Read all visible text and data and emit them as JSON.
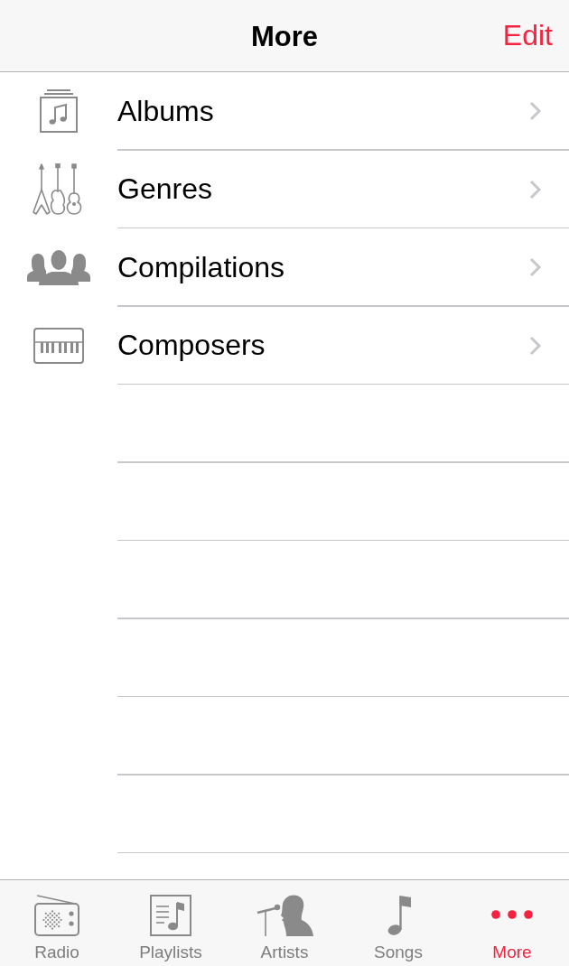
{
  "nav_bar": {
    "title": "More",
    "edit_button": "Edit"
  },
  "list": {
    "items": [
      {
        "label": "Albums"
      },
      {
        "label": "Genres"
      },
      {
        "label": "Compilations"
      },
      {
        "label": "Composers"
      }
    ]
  },
  "tab_bar": {
    "tabs": [
      {
        "label": "Radio",
        "selected": false
      },
      {
        "label": "Playlists",
        "selected": false
      },
      {
        "label": "Artists",
        "selected": false
      },
      {
        "label": "Songs",
        "selected": false
      },
      {
        "label": "More",
        "selected": true
      }
    ]
  }
}
